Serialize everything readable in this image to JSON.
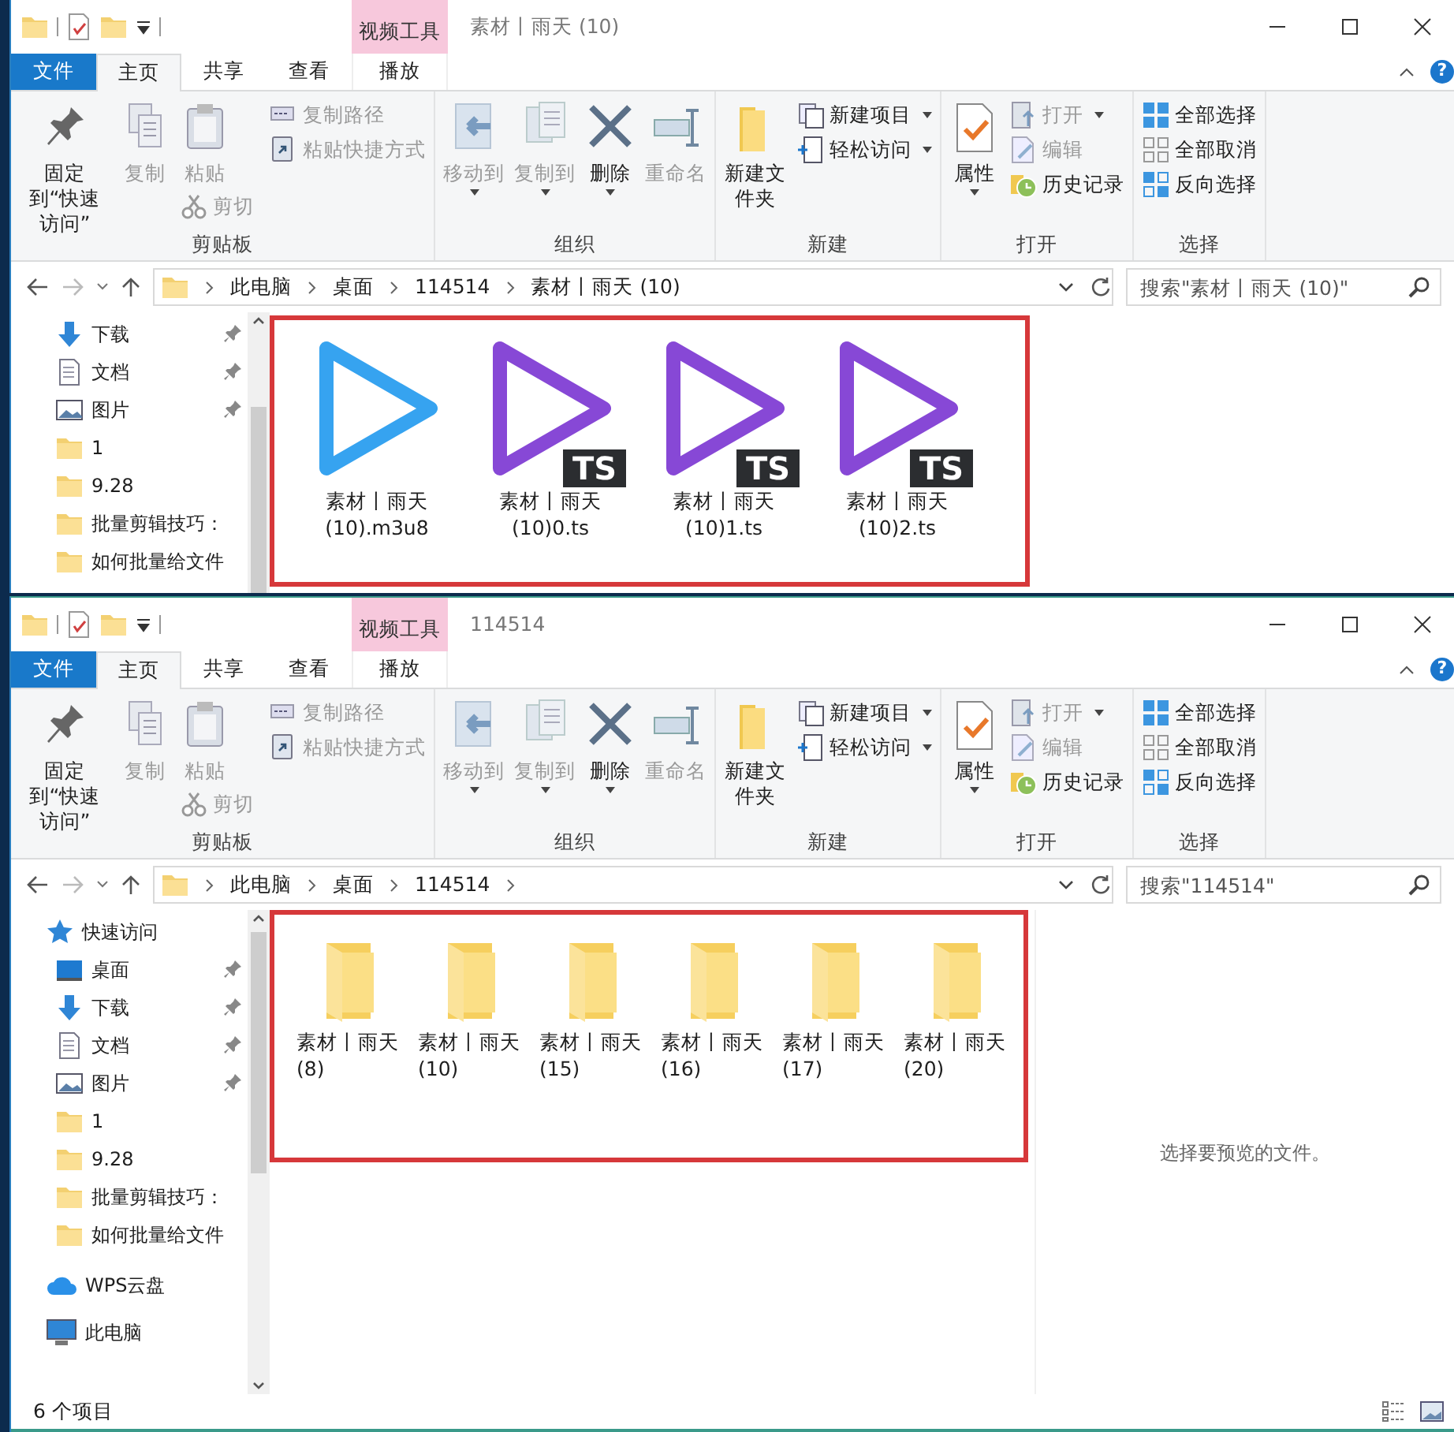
{
  "windows": [
    {
      "title": "素材丨雨天 (10)",
      "context_label": "视频工具",
      "help_glyph": "?",
      "tabs": [
        {
          "label": "文件",
          "kind": "file",
          "selected": false
        },
        {
          "label": "主页",
          "kind": "tab",
          "selected": true
        },
        {
          "label": "共享",
          "kind": "tab",
          "selected": false
        },
        {
          "label": "查看",
          "kind": "tab",
          "selected": false
        },
        {
          "label": "播放",
          "kind": "context",
          "selected": false
        }
      ],
      "ribbon": [
        {
          "label": "剪贴板",
          "columns": [
            [
              {
                "label": "固定到“快速访问”",
                "kind": "large",
                "disabled": false
              }
            ],
            [
              {
                "label": "复制",
                "kind": "large",
                "disabled": true
              }
            ],
            [
              {
                "label": "粘贴",
                "kind": "large",
                "disabled": true
              },
              {
                "label": "剪切",
                "kind": "small",
                "disabled": true
              }
            ],
            [
              {
                "label": "复制路径",
                "kind": "small",
                "disabled": true
              },
              {
                "label": "粘贴快捷方式",
                "kind": "small",
                "disabled": true
              }
            ]
          ]
        },
        {
          "label": "组织",
          "columns": [
            [
              {
                "label": "移动到",
                "kind": "large",
                "disabled": true,
                "dropdown": true
              }
            ],
            [
              {
                "label": "复制到",
                "kind": "large",
                "disabled": true,
                "dropdown": true
              }
            ],
            [
              {
                "label": "删除",
                "kind": "large",
                "disabled": false,
                "dropdown": true
              }
            ],
            [
              {
                "label": "重命名",
                "kind": "large",
                "disabled": true
              }
            ]
          ]
        },
        {
          "label": "新建",
          "columns": [
            [
              {
                "label": "新建文件夹",
                "kind": "large",
                "disabled": false
              }
            ],
            [
              {
                "label": "新建项目",
                "kind": "small",
                "disabled": false,
                "dropdown": true
              },
              {
                "label": "轻松访问",
                "kind": "small",
                "disabled": false,
                "dropdown": true
              }
            ]
          ]
        },
        {
          "label": "打开",
          "columns": [
            [
              {
                "label": "属性",
                "kind": "large",
                "disabled": false,
                "dropdown": true
              }
            ],
            [
              {
                "label": "打开",
                "kind": "small",
                "disabled": true,
                "dropdown": true
              },
              {
                "label": "编辑",
                "kind": "small",
                "disabled": true
              },
              {
                "label": "历史记录",
                "kind": "small",
                "disabled": false
              }
            ]
          ]
        },
        {
          "label": "选择",
          "columns": [
            [
              {
                "label": "全部选择",
                "kind": "small",
                "disabled": false
              },
              {
                "label": "全部取消",
                "kind": "small",
                "disabled": false
              },
              {
                "label": "反向选择",
                "kind": "small",
                "disabled": false
              }
            ]
          ]
        }
      ],
      "path": [
        "此电脑",
        "桌面",
        "114514",
        "素材丨雨天 (10)"
      ],
      "search": {
        "placeholder": "搜索\"素材丨雨天 (10)\""
      },
      "sidebar": [
        {
          "label": "下载",
          "kind": "downloads",
          "pinned": true
        },
        {
          "label": "文档",
          "kind": "documents",
          "pinned": true
        },
        {
          "label": "图片",
          "kind": "pictures",
          "pinned": true
        },
        {
          "label": "1",
          "kind": "folder",
          "pinned": false
        },
        {
          "label": "9.28",
          "kind": "folder",
          "pinned": false
        },
        {
          "label": "批量剪辑技巧：",
          "kind": "folder",
          "pinned": false
        },
        {
          "label": "如何批量给文件",
          "kind": "folder",
          "pinned": false
        }
      ],
      "files": [
        {
          "name": "素材丨雨天 (10).m3u8",
          "kind": "playlist"
        },
        {
          "name": "素材丨雨天 (10)0.ts",
          "kind": "ts",
          "badge": "TS"
        },
        {
          "name": "素材丨雨天 (10)1.ts",
          "kind": "ts",
          "badge": "TS"
        },
        {
          "name": "素材丨雨天 (10)2.ts",
          "kind": "ts",
          "badge": "TS"
        }
      ],
      "highlighted": true
    },
    {
      "title": "114514",
      "context_label": "视频工具",
      "help_glyph": "?",
      "tabs": [
        {
          "label": "文件",
          "kind": "file",
          "selected": false
        },
        {
          "label": "主页",
          "kind": "tab",
          "selected": true
        },
        {
          "label": "共享",
          "kind": "tab",
          "selected": false
        },
        {
          "label": "查看",
          "kind": "tab",
          "selected": false
        },
        {
          "label": "播放",
          "kind": "context",
          "selected": false
        }
      ],
      "ribbon": [
        {
          "label": "剪贴板",
          "columns": [
            [
              {
                "label": "固定到“快速访问”",
                "kind": "large",
                "disabled": false
              }
            ],
            [
              {
                "label": "复制",
                "kind": "large",
                "disabled": true
              }
            ],
            [
              {
                "label": "粘贴",
                "kind": "large",
                "disabled": true
              },
              {
                "label": "剪切",
                "kind": "small",
                "disabled": true
              }
            ],
            [
              {
                "label": "复制路径",
                "kind": "small",
                "disabled": true
              },
              {
                "label": "粘贴快捷方式",
                "kind": "small",
                "disabled": true
              }
            ]
          ]
        },
        {
          "label": "组织",
          "columns": [
            [
              {
                "label": "移动到",
                "kind": "large",
                "disabled": true,
                "dropdown": true
              }
            ],
            [
              {
                "label": "复制到",
                "kind": "large",
                "disabled": true,
                "dropdown": true
              }
            ],
            [
              {
                "label": "删除",
                "kind": "large",
                "disabled": false,
                "dropdown": true
              }
            ],
            [
              {
                "label": "重命名",
                "kind": "large",
                "disabled": true
              }
            ]
          ]
        },
        {
          "label": "新建",
          "columns": [
            [
              {
                "label": "新建文件夹",
                "kind": "large",
                "disabled": false
              }
            ],
            [
              {
                "label": "新建项目",
                "kind": "small",
                "disabled": false,
                "dropdown": true
              },
              {
                "label": "轻松访问",
                "kind": "small",
                "disabled": false,
                "dropdown": true
              }
            ]
          ]
        },
        {
          "label": "打开",
          "columns": [
            [
              {
                "label": "属性",
                "kind": "large",
                "disabled": false,
                "dropdown": true
              }
            ],
            [
              {
                "label": "打开",
                "kind": "small",
                "disabled": true,
                "dropdown": true
              },
              {
                "label": "编辑",
                "kind": "small",
                "disabled": true
              },
              {
                "label": "历史记录",
                "kind": "small",
                "disabled": false
              }
            ]
          ]
        },
        {
          "label": "选择",
          "columns": [
            [
              {
                "label": "全部选择",
                "kind": "small",
                "disabled": false
              },
              {
                "label": "全部取消",
                "kind": "small",
                "disabled": false
              },
              {
                "label": "反向选择",
                "kind": "small",
                "disabled": false
              }
            ]
          ]
        }
      ],
      "path": [
        "此电脑",
        "桌面",
        "114514"
      ],
      "search": {
        "placeholder": "搜索\"114514\""
      },
      "sidebar": [
        {
          "label": "快速访问",
          "kind": "quick-access",
          "pinned": false
        },
        {
          "label": "桌面",
          "kind": "desktop",
          "pinned": true
        },
        {
          "label": "下载",
          "kind": "downloads",
          "pinned": true
        },
        {
          "label": "文档",
          "kind": "documents",
          "pinned": true
        },
        {
          "label": "图片",
          "kind": "pictures",
          "pinned": true
        },
        {
          "label": "1",
          "kind": "folder",
          "pinned": false
        },
        {
          "label": "9.28",
          "kind": "folder",
          "pinned": false
        },
        {
          "label": "批量剪辑技巧：",
          "kind": "folder",
          "pinned": false
        },
        {
          "label": "如何批量给文件",
          "kind": "folder",
          "pinned": false
        },
        {
          "label": "WPS云盘",
          "kind": "cloud",
          "pinned": false
        },
        {
          "label": "此电脑",
          "kind": "computer",
          "pinned": false
        }
      ],
      "files": [
        {
          "name": "素材丨雨天 (8)",
          "kind": "folder"
        },
        {
          "name": "素材丨雨天 (10)",
          "kind": "folder"
        },
        {
          "name": "素材丨雨天 (15)",
          "kind": "folder"
        },
        {
          "name": "素材丨雨天 (16)",
          "kind": "folder"
        },
        {
          "name": "素材丨雨天 (17)",
          "kind": "folder"
        },
        {
          "name": "素材丨雨天 (20)",
          "kind": "folder"
        }
      ],
      "highlighted": true,
      "preview_text": "选择要预览的文件。",
      "status_bar": "6 个项目"
    }
  ]
}
